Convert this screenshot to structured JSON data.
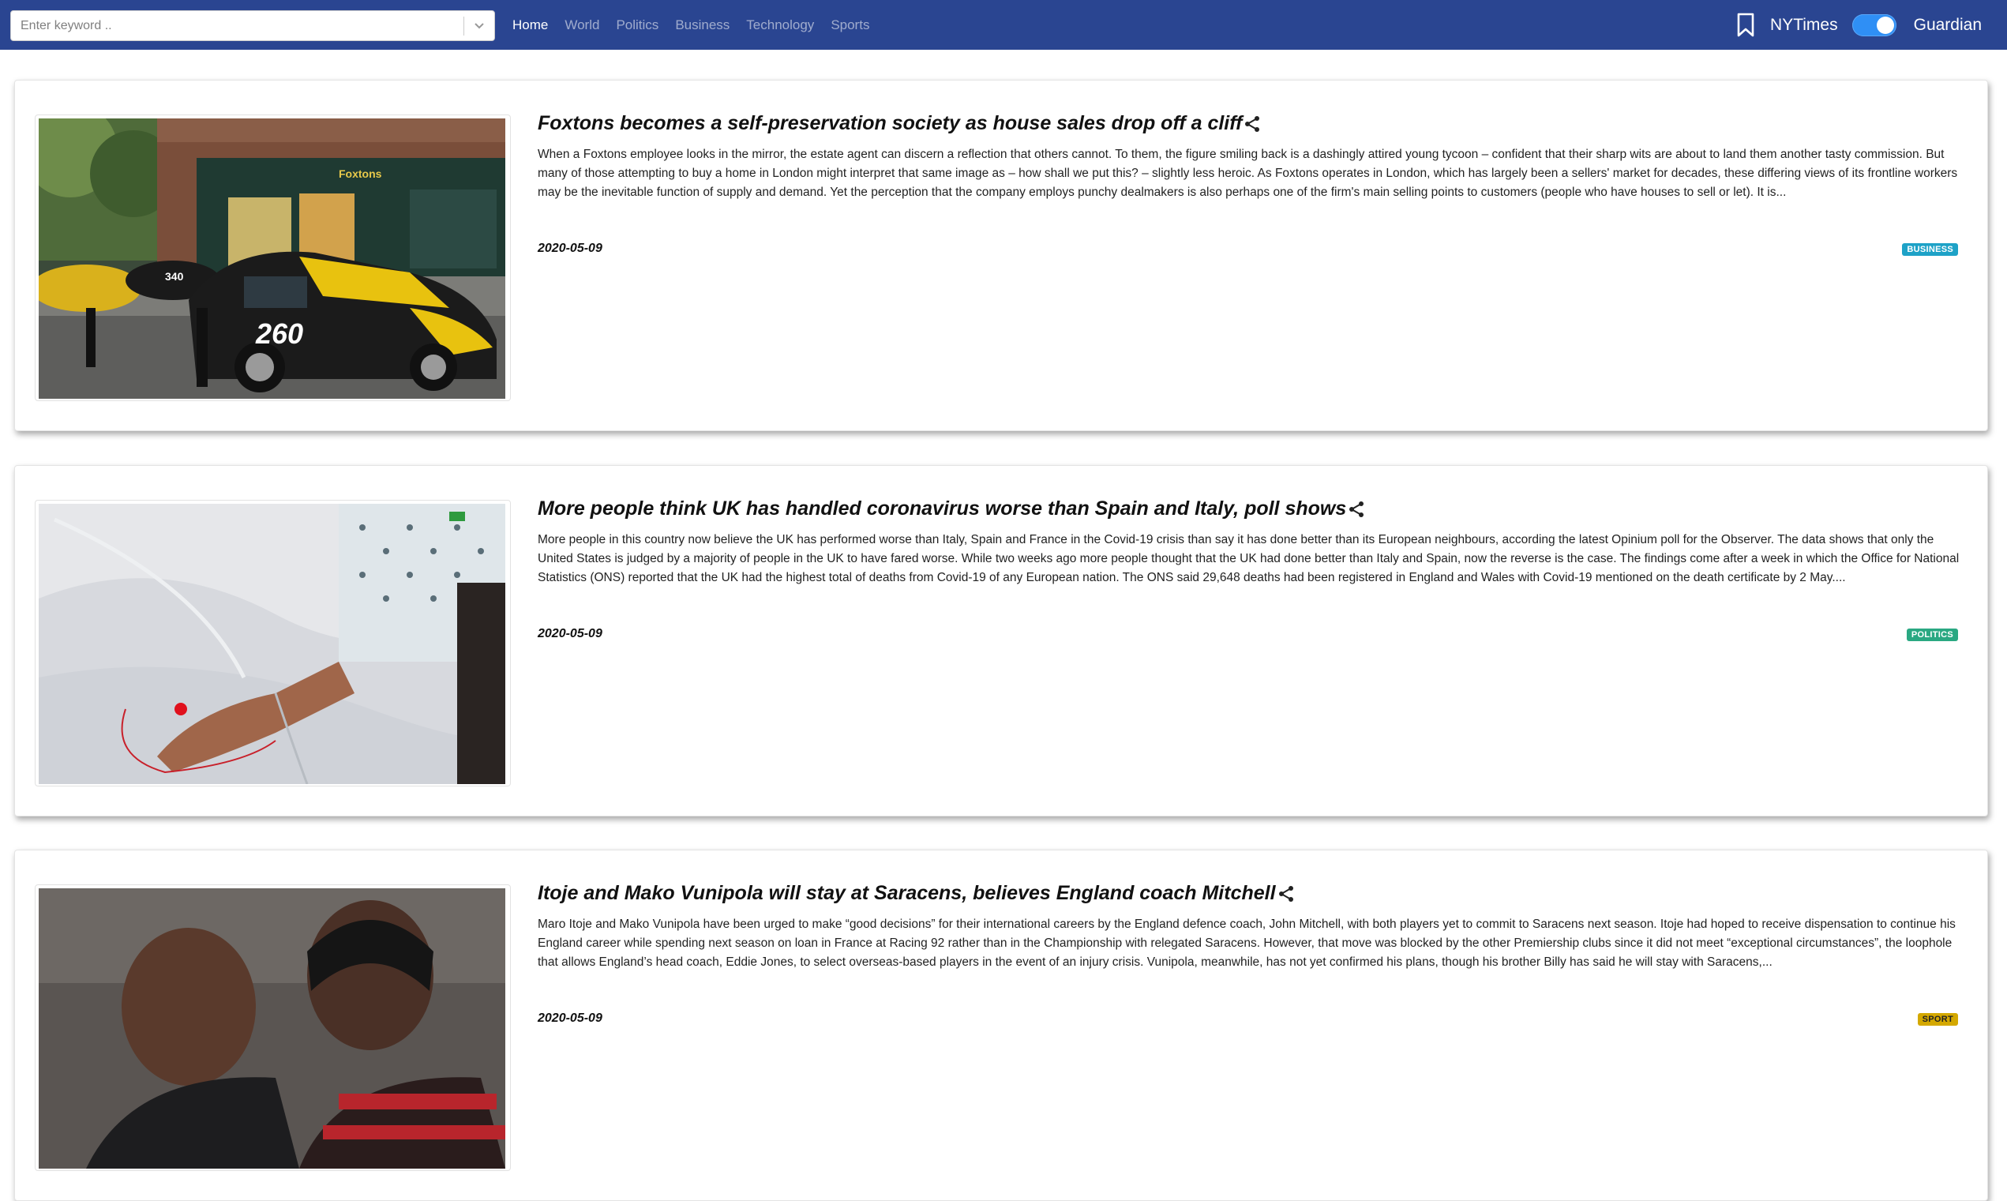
{
  "search": {
    "placeholder": "Enter keyword .."
  },
  "nav": {
    "links": [
      "Home",
      "World",
      "Politics",
      "Business",
      "Technology",
      "Sports"
    ],
    "active": "Home"
  },
  "sources": {
    "left": "NYTimes",
    "right": "Guardian",
    "selected": "Guardian"
  },
  "articles": [
    {
      "title": "Foxtons becomes a self-preservation society as house sales drop off a cliff",
      "description": "When a Foxtons employee looks in the mirror, the estate agent can discern a reflection that others cannot. To them, the figure smiling back is a dashingly attired young tycoon – confident that their sharp wits are about to land them another tasty commission. But many of those attempting to buy a home in London might interpret that same image as – how shall we put this? – slightly less heroic. As Foxtons operates in London, which has largely been a sellers' market for decades, these differing views of its frontline workers may be the inevitable function of supply and demand. Yet the perception that the company employs punchy dealmakers is also perhaps one of the firm's main selling points to customers (people who have houses to sell or let). It is...",
      "date": "2020-05-09",
      "section": "BUSINESS",
      "section_color": "#1ea2c7",
      "image_text": {
        "shop_sign": "Foxtons",
        "car_number": "260",
        "car_number_2": "340"
      }
    },
    {
      "title": "More people think UK has handled coronavirus worse than Spain and Italy, poll shows",
      "description": "More people in this country now believe the UK has performed worse than Italy, Spain and France in the Covid-19 crisis than say it has done better than its European neighbours, according the latest Opinium poll for the Observer. The data shows that only the United States is judged by a majority of people in the UK to have fared worse. While two weeks ago more people thought that the UK had done better than Italy and Spain, now the reverse is the case. The findings come after a week in which the Office for National Statistics (ONS) reported that the UK had the highest total of deaths from Covid-19 of any European nation. The ONS said 29,648 deaths had been registered in England and Wales with Covid-19 mentioned on the death certificate by 2 May....",
      "date": "2020-05-09",
      "section": "POLITICS",
      "section_color": "#2aa882"
    },
    {
      "title": "Itoje and Mako Vunipola will stay at Saracens, believes England coach Mitchell",
      "description": "Maro Itoje and Mako Vunipola have been urged to make “good decisions” for their international careers by the England defence coach, John Mitchell, with both players yet to commit to Saracens next season. Itoje had hoped to receive dispensation to continue his England career while spending next season on loan in France at Racing 92 rather than in the Championship with relegated Saracens. However, that move was blocked by the other Premiership clubs since it did not meet “exceptional circumstances”, the loophole that allows England’s head coach, Eddie Jones, to select overseas-based players in the event of an injury crisis. Vunipola, meanwhile, has not yet confirmed his plans, though his brother Billy has said he will stay with Saracens,...",
      "date": "2020-05-09",
      "section": "SPORT",
      "section_color": "#d4a800"
    }
  ]
}
